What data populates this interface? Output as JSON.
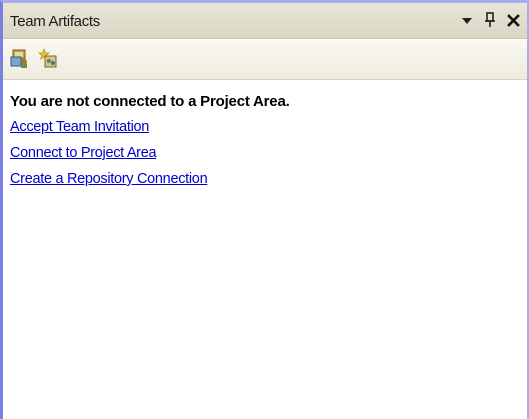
{
  "panel": {
    "title": "Team Artifacts",
    "controls": [
      "dropdown-menu-icon",
      "pin-icon",
      "close-icon"
    ]
  },
  "toolbar": {
    "buttons": [
      "team-artifacts-icon",
      "new-connection-icon"
    ]
  },
  "content": {
    "status_message": "You are not connected to a Project Area.",
    "links": [
      "Accept Team Invitation",
      "Connect to Project Area",
      "Create a Repository Connection"
    ]
  },
  "colors": {
    "link": "#0000cc",
    "frame_border": "#7b7fe0",
    "titlebar": "#e2dfcf"
  }
}
